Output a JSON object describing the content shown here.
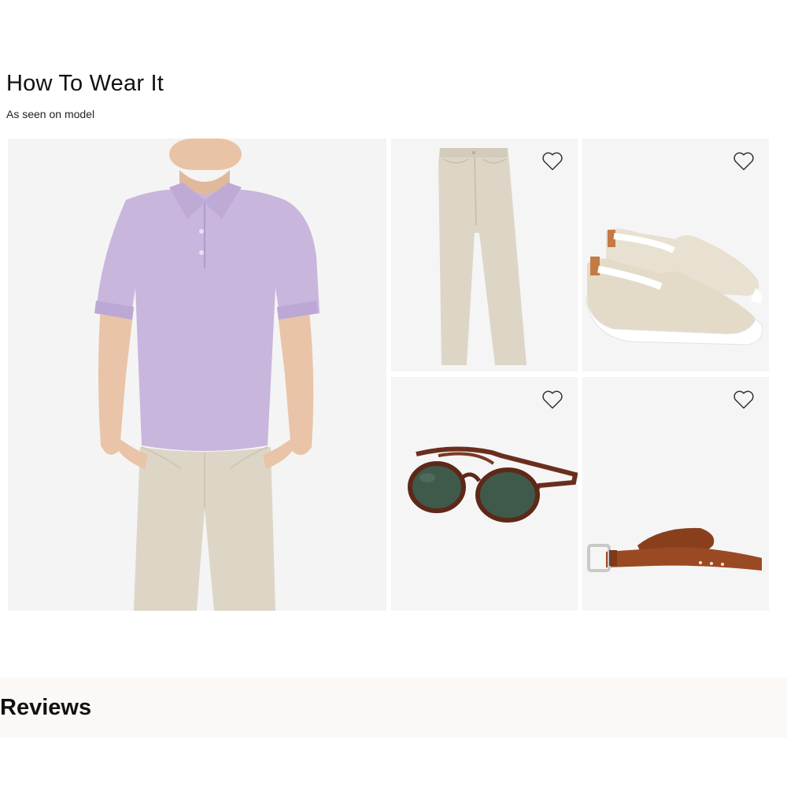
{
  "section": {
    "title": "How To Wear It",
    "subtitle": "As seen on model"
  },
  "products": [
    {
      "id": "model",
      "item": "purple polo shirt and khaki pants on model"
    },
    {
      "id": "pants",
      "item": "stone chino pants",
      "wishlist_icon": "heart-outline-icon"
    },
    {
      "id": "shoes",
      "item": "canvas slip-on sneakers",
      "wishlist_icon": "heart-outline-icon"
    },
    {
      "id": "glasses",
      "item": "tortoise aviator sunglasses",
      "wishlist_icon": "heart-outline-icon"
    },
    {
      "id": "belt",
      "item": "brown leather belt",
      "wishlist_icon": "heart-outline-icon"
    }
  ],
  "reviews": {
    "title": "Reviews"
  },
  "colors": {
    "polo": "#c8b6dd",
    "khaki": "#ddd6c7",
    "tortoise": "#6b2e1c",
    "lens": "#3f5a4a",
    "belt": "#9a4a22",
    "reviews_bg": "#fcf8f6"
  }
}
